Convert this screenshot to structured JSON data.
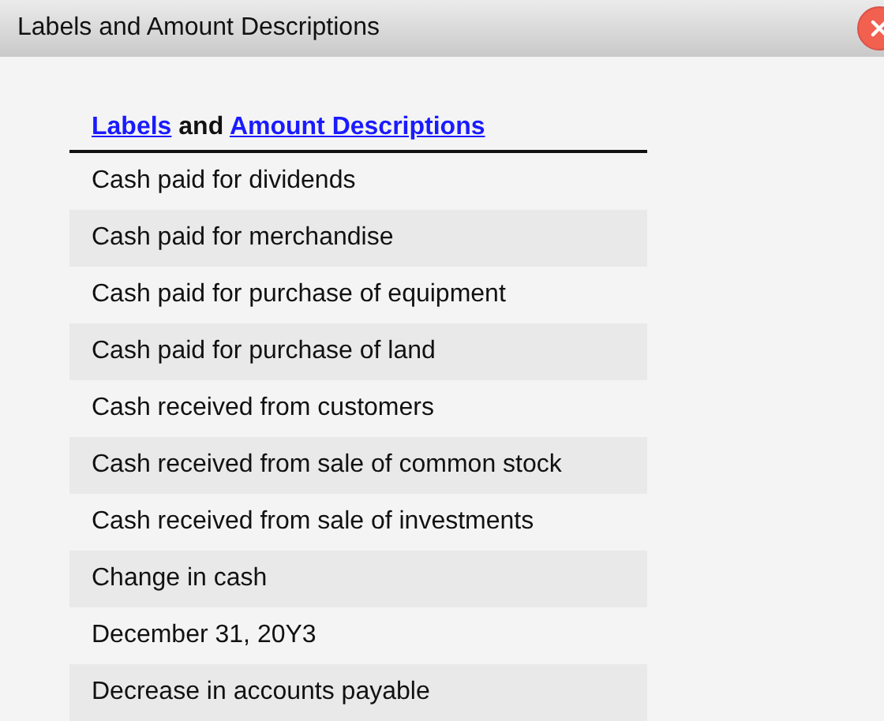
{
  "window": {
    "title": "Labels and Amount Descriptions"
  },
  "table": {
    "header": [
      {
        "kind": "link",
        "text": "Labels"
      },
      {
        "kind": "text",
        "text": "and"
      },
      {
        "kind": "link",
        "text": "Amount Descriptions"
      }
    ],
    "rows": [
      "Cash paid for dividends",
      "Cash paid for merchandise",
      "Cash paid for purchase of equipment",
      "Cash paid for purchase of land",
      "Cash received from customers",
      "Cash received from sale of common stock",
      "Cash received from sale of investments",
      "Change in cash",
      "December 31, 20Y3",
      "Decrease in accounts payable"
    ]
  }
}
